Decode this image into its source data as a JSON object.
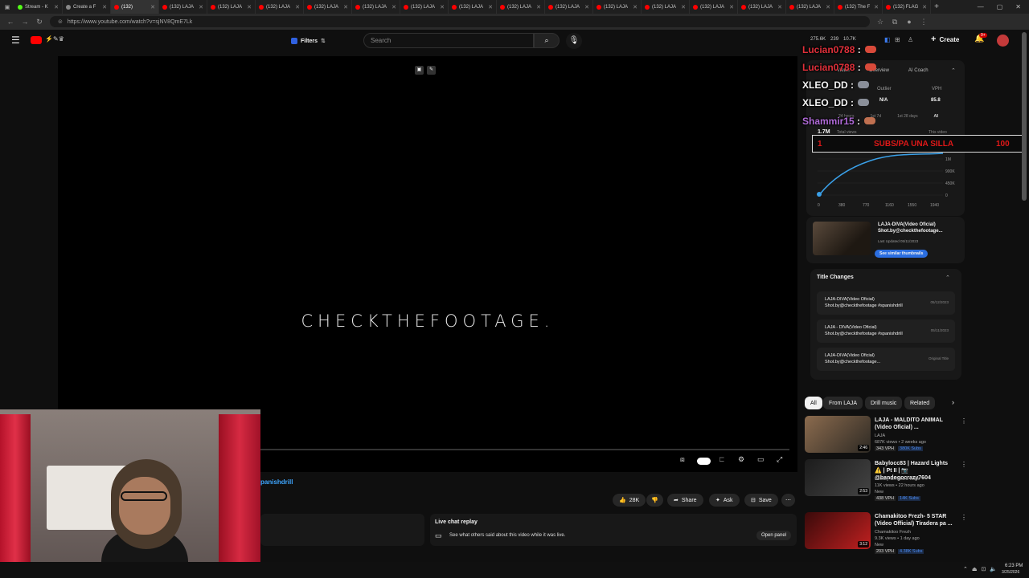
{
  "browser": {
    "tabs": [
      {
        "label": "Stream - K"
      },
      {
        "label": "Create a F"
      },
      {
        "label": "(132)"
      },
      {
        "label": "(132) LAJA"
      },
      {
        "label": "(132) LAJA"
      },
      {
        "label": "(132) LAJA"
      },
      {
        "label": "(132) LAJA"
      },
      {
        "label": "(132) LAJA"
      },
      {
        "label": "(132) LAJA"
      },
      {
        "label": "(132) LAJA"
      },
      {
        "label": "(132) LAJA"
      },
      {
        "label": "(132) LAJA"
      },
      {
        "label": "(132) LAJA"
      },
      {
        "label": "(132) LAJA"
      },
      {
        "label": "(132) LAJA"
      },
      {
        "label": "(132) LAJA"
      },
      {
        "label": "(132) LAJA"
      },
      {
        "label": "(132) The F"
      },
      {
        "label": "(132) FLAG"
      }
    ],
    "url": "https://www.youtube.com/watch?v=sjNV8QmE7Lk"
  },
  "header": {
    "filters_label": "Filters",
    "search_placeholder": "Search",
    "stats": [
      "275.6K",
      "239",
      "10.7K"
    ],
    "create_label": "Create",
    "notif_count": "9+"
  },
  "player": {
    "title_card": "CHECKTHEFOOTAGE.",
    "hashtag": "panishdrill"
  },
  "actions": {
    "likes": "28K",
    "share": "Share",
    "ask": "Ask",
    "save": "Save"
  },
  "live_chat": {
    "title": "Live chat replay",
    "desc": "See what others said about this video while it was live.",
    "open_panel": "Open panel"
  },
  "overlay_chat": [
    {
      "user": "Lucian0788",
      "color": "#e0303a"
    },
    {
      "user": "Lucian0788",
      "color": "#e0303a"
    },
    {
      "user": "XLEO_DD",
      "color": "#f4f4f4"
    },
    {
      "user": "XLEO_DD",
      "color": "#f4f4f4"
    },
    {
      "user": "Shammir15",
      "color": "#b06ad8"
    }
  ],
  "banner": {
    "left": "1",
    "center": "SUBS/PA UNA SILLA",
    "right": "100"
  },
  "analytics": {
    "tabs": [
      "Views",
      "Overview",
      "AI Coach"
    ],
    "outlier_label": "Outlier",
    "outlier_value": "N/A",
    "vph_label": "VPH",
    "vph_value": "85.8",
    "ranges": [
      "24 hours",
      "1st 7d",
      "1st 28 days",
      "All"
    ],
    "total_views": "1.7M",
    "total_label": "Total views",
    "this_video": "This video",
    "y_ticks": [
      "1M",
      "900K",
      "450K",
      "0"
    ],
    "x_ticks": [
      "0",
      "380",
      "770",
      "1160",
      "1550",
      "1940"
    ]
  },
  "thumb_card": {
    "title": "LAJA-DIVA(Video Oficial) Shot.by@checkthefootage...",
    "updated": "Last Updated 05/11/2023",
    "button": "See similar thumbnails"
  },
  "title_changes": {
    "heading": "Title Changes",
    "items": [
      {
        "line1": "LAJA-DIVA(Video Oficial)",
        "line2": "Shot.by@checkthefootage #spanishdrill",
        "date": "05/12/2023"
      },
      {
        "line1": "LAJA - DIVA(Video Oficial)",
        "line2": "Shot.by@checkthefootage #spanishdrill",
        "date": "05/11/2023"
      },
      {
        "line1": "LAJA-DIVA(Video Oficial)",
        "line2": "Shot.by@checkthefootage...",
        "date": "Original Title"
      }
    ]
  },
  "chips": [
    "All",
    "From LAJA",
    "Drill music",
    "Related"
  ],
  "recommendations": [
    {
      "title": "LAJA - MALDITO ANIMAL (Video Oficial) ...",
      "channel": "LAJA",
      "meta": "687K views • 2 weeks ago",
      "vph": "343 VPH",
      "subs": "380K Subs",
      "duration": "2:46",
      "colors": [
        "#8b6b4e",
        "#2e2a24"
      ]
    },
    {
      "title": "Babylocc83 | Hazard Lights ⚠️ | Pt II | 📷 @bandogocrazy7604",
      "channel": "ShotBy OA and 2 more",
      "meta": "11K views • 22 hours ago",
      "tag": "New",
      "vph": "438 VPH",
      "subs": "14K Subs",
      "duration": "2:53",
      "colors": [
        "#1c1c1c",
        "#444"
      ]
    },
    {
      "title": "Chamakitoo Frezh- 5 STAR (Video Official) Tiradera pa ...",
      "channel": "Chamakitoo Frezh",
      "meta": "9.3K views • 1 day ago",
      "tag": "New",
      "vph": "203 VPH",
      "subs": "4.38K Subs",
      "duration": "3:12",
      "colors": [
        "#3a0a0a",
        "#c02020"
      ]
    }
  ],
  "taskbar": {
    "time": "6:23 PM",
    "date": "3/25/2026"
  }
}
